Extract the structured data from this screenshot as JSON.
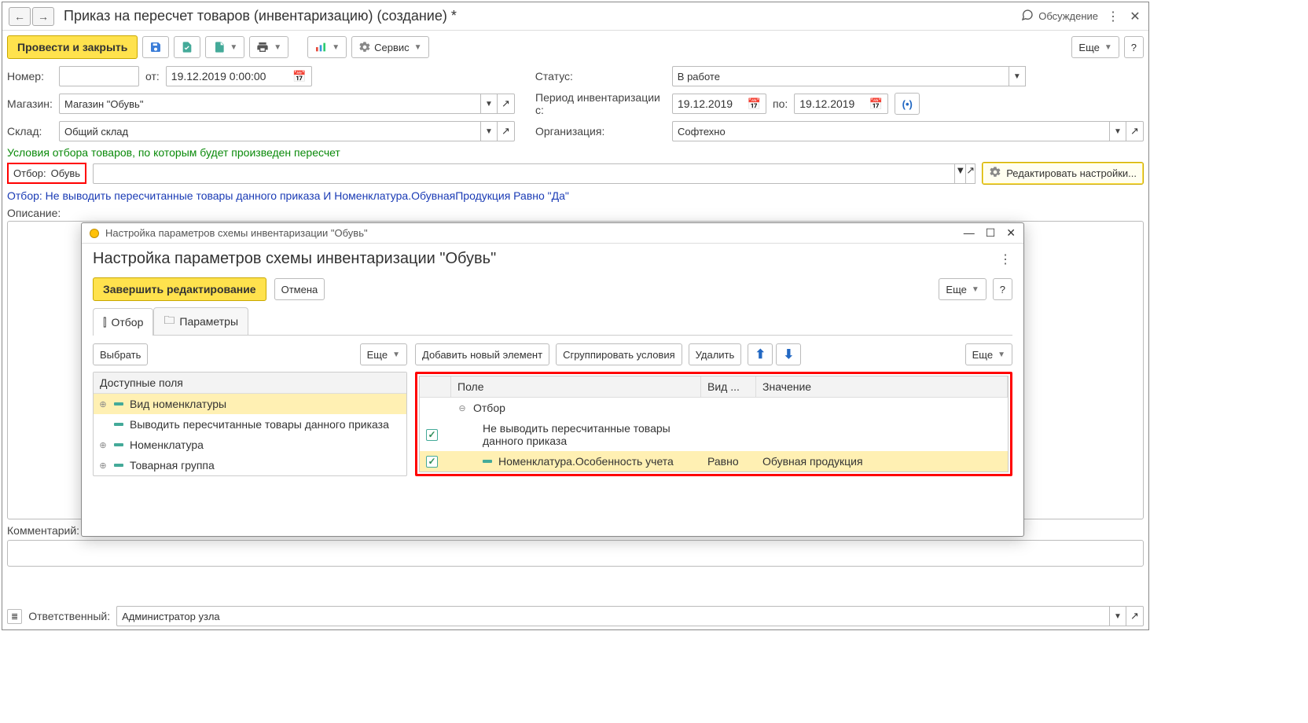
{
  "header": {
    "title": "Приказ на пересчет товаров (инвентаризацию) (создание) *",
    "discussion": "Обсуждение"
  },
  "toolbar": {
    "post_close": "Провести и закрыть",
    "service": "Сервис",
    "more": "Еще",
    "help": "?"
  },
  "form": {
    "number_label": "Номер:",
    "number_value": "",
    "from_label": "от:",
    "from_value": "19.12.2019  0:00:00",
    "status_label": "Статус:",
    "status_value": "В работе",
    "store_label": "Магазин:",
    "store_value": "Магазин \"Обувь\"",
    "period_label": "Период инвентаризации с:",
    "period_from": "19.12.2019",
    "period_to_label": "по:",
    "period_to": "19.12.2019",
    "warehouse_label": "Склад:",
    "warehouse_value": "Общий склад",
    "org_label": "Организация:",
    "org_value": "Софтехно",
    "green_text": "Условия отбора товаров, по которым будет произведен пересчет",
    "filter_label": "Отбор:",
    "filter_value": "Обувь",
    "edit_settings": "Редактировать настройки...",
    "blue_text": "Отбор: Не выводить пересчитанные товары данного приказа И Номенклатура.ОбувнаяПродукция Равно \"Да\"",
    "descr_label": "Описание:",
    "comment_label": "Комментарий:"
  },
  "footer": {
    "responsible_label": "Ответственный:",
    "responsible_value": "Администратор узла"
  },
  "modal": {
    "wintitle": "Настройка параметров схемы инвентаризации \"Обувь\"",
    "header": "Настройка параметров схемы инвентаризации \"Обувь\"",
    "finish": "Завершить редактирование",
    "cancel": "Отмена",
    "more": "Еще",
    "help": "?",
    "tab_filter": "Отбор",
    "tab_params": "Параметры",
    "left": {
      "select": "Выбрать",
      "more": "Еще",
      "header": "Доступные поля",
      "rows": [
        {
          "label": "Вид номенклатуры",
          "expand": true,
          "selected": true
        },
        {
          "label": "Выводить пересчитанные товары данного приказа",
          "expand": false,
          "selected": false
        },
        {
          "label": "Номенклатура",
          "expand": true,
          "selected": false
        },
        {
          "label": "Товарная группа",
          "expand": true,
          "selected": false
        }
      ]
    },
    "right": {
      "add": "Добавить новый элемент",
      "group": "Сгруппировать условия",
      "delete": "Удалить",
      "more": "Еще",
      "head_field": "Поле",
      "head_comp": "Вид ...",
      "head_val": "Значение",
      "root": "Отбор",
      "rows": [
        {
          "checked": true,
          "field": "Не выводить пересчитанные товары данного приказа",
          "comp": "",
          "val": "",
          "selected": false,
          "dash": false
        },
        {
          "checked": true,
          "field": "Номенклатура.Особенность учета",
          "comp": "Равно",
          "val": "Обувная продукция",
          "selected": true,
          "dash": true
        }
      ]
    }
  }
}
